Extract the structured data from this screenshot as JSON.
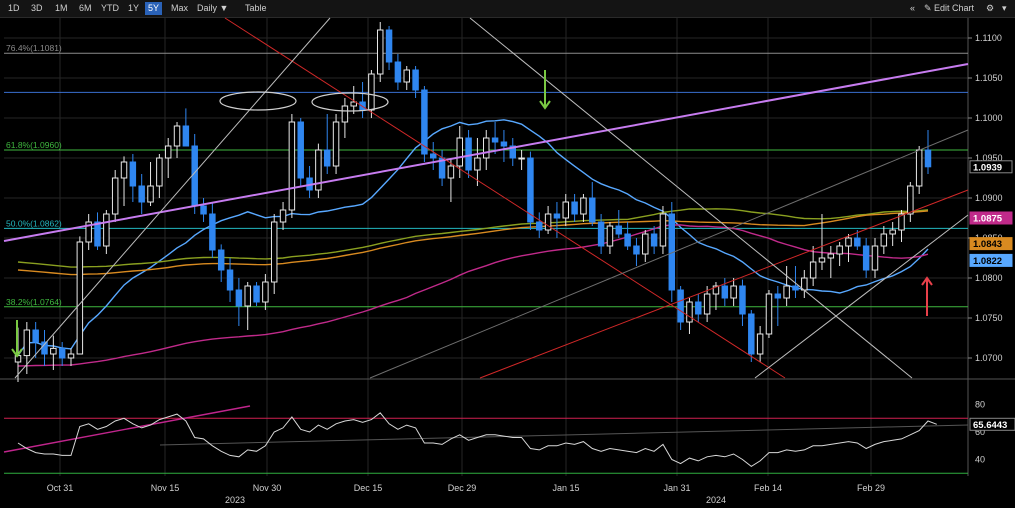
{
  "toolbar": {
    "ranges": [
      "1D",
      "3D",
      "1M",
      "6M",
      "YTD",
      "1Y",
      "5Y",
      "Max"
    ],
    "active_range": "5Y",
    "period": "Daily ▼",
    "table": "Table",
    "collapse": "«",
    "edit_chart": "✎ Edit Chart",
    "settings": "⚙",
    "minimize": "▾"
  },
  "colors": {
    "up_candle": "#e8e8e8",
    "down_candle": "#2f86f0",
    "fib": "#8c8c8c",
    "fib_618": "#3fb83f",
    "fib_382": "#3fb83f",
    "fib_500": "#23b8c0",
    "sma_blue": "#58a8ff",
    "sma_magenta": "#c02a8a",
    "sma_olive": "#8aa020",
    "sma_orange": "#d88a20",
    "trend_purple": "#c77cf0",
    "red_line": "#d02828",
    "white_line": "#bdbdbd",
    "rsi_line": "#d8d8d8"
  },
  "chart_data": {
    "type": "candlestick",
    "instrument_note": "",
    "y_axis": {
      "range": [
        1.0675,
        1.1125
      ],
      "ticks": [
        "1.1100",
        "1.1050",
        "1.1000",
        "1.0950",
        "1.0900",
        "1.0850",
        "1.0800",
        "1.0750",
        "1.0700"
      ],
      "tick_values": [
        1.11,
        1.105,
        1.1,
        1.095,
        1.09,
        1.085,
        1.08,
        1.075,
        1.07
      ]
    },
    "x_axis": {
      "ticks": [
        "Oct 31",
        "Nov 15",
        "Nov 30",
        "Dec 15",
        "Dec 29",
        "Jan 15",
        "Jan 31",
        "Feb 14",
        "Feb 29"
      ],
      "years": [
        "2023",
        "2024"
      ],
      "grid": true
    },
    "fib_levels": [
      {
        "label": "76.4%(1.1081)",
        "value": 1.1081
      },
      {
        "label": "61.8%(1.0960)",
        "value": 1.096
      },
      {
        "label": "50.0%(1.0862)",
        "value": 1.0862
      },
      {
        "label": "38.2%(1.0764)",
        "value": 1.0764
      }
    ],
    "horizontal_line": 1.1032,
    "price_tags": [
      {
        "value": 1.0939,
        "text": "1.0939",
        "bg": "#000000",
        "fg": "#ffffff"
      },
      {
        "value": 1.0875,
        "text": "1.0875",
        "bg": "#c02a8a",
        "fg": "#ffffff"
      },
      {
        "value": 1.0843,
        "text": "1.0843",
        "bg": "#d88a20",
        "fg": "#000000"
      },
      {
        "value": 1.0822,
        "text": "1.0822",
        "bg": "#58a8ff",
        "fg": "#000000"
      }
    ],
    "ohlc": [
      [
        1.0695,
        1.0738,
        1.067,
        1.0703
      ],
      [
        1.0703,
        1.0745,
        1.068,
        1.0735
      ],
      [
        1.0735,
        1.0745,
        1.07,
        1.072
      ],
      [
        1.072,
        1.0735,
        1.069,
        1.0705
      ],
      [
        1.0705,
        1.0728,
        1.0685,
        1.0712
      ],
      [
        1.0712,
        1.072,
        1.069,
        1.07
      ],
      [
        1.07,
        1.0712,
        1.069,
        1.0705
      ],
      [
        1.0705,
        1.0852,
        1.0705,
        1.0845
      ],
      [
        1.0845,
        1.088,
        1.0835,
        1.087
      ],
      [
        1.087,
        1.0882,
        1.0835,
        1.084
      ],
      [
        1.084,
        1.0885,
        1.083,
        1.088
      ],
      [
        1.088,
        1.0935,
        1.087,
        1.0925
      ],
      [
        1.0925,
        1.0952,
        1.089,
        1.0945
      ],
      [
        1.0945,
        1.0955,
        1.0895,
        1.0915
      ],
      [
        1.0915,
        1.093,
        1.088,
        1.0895
      ],
      [
        1.0895,
        1.0945,
        1.089,
        1.0915
      ],
      [
        1.0915,
        1.0955,
        1.09,
        1.095
      ],
      [
        1.095,
        1.0975,
        1.0925,
        1.0965
      ],
      [
        1.0965,
        1.0995,
        1.095,
        1.099
      ],
      [
        1.099,
        1.1012,
        1.0965,
        1.0965
      ],
      [
        1.0965,
        1.098,
        1.088,
        1.089
      ],
      [
        1.089,
        1.09,
        1.087,
        1.088
      ],
      [
        1.088,
        1.0895,
        1.0825,
        1.0835
      ],
      [
        1.0835,
        1.0842,
        1.0795,
        1.081
      ],
      [
        1.081,
        1.0825,
        1.077,
        1.0785
      ],
      [
        1.0785,
        1.08,
        1.074,
        1.0765
      ],
      [
        1.0765,
        1.0795,
        1.0735,
        1.079
      ],
      [
        1.079,
        1.0795,
        1.0765,
        1.077
      ],
      [
        1.077,
        1.0805,
        1.076,
        1.0795
      ],
      [
        1.0795,
        1.088,
        1.078,
        1.087
      ],
      [
        1.087,
        1.0895,
        1.086,
        1.0885
      ],
      [
        1.0885,
        1.1005,
        1.0875,
        1.0995
      ],
      [
        1.0995,
        1.1,
        1.0915,
        1.0925
      ],
      [
        1.0925,
        1.094,
        1.09,
        1.091
      ],
      [
        1.091,
        1.0968,
        1.09,
        1.096
      ],
      [
        1.096,
        1.1005,
        1.093,
        1.094
      ],
      [
        1.094,
        1.1005,
        1.093,
        1.0995
      ],
      [
        1.0995,
        1.1025,
        1.0975,
        1.1015
      ],
      [
        1.1015,
        1.104,
        1.1005,
        1.102
      ],
      [
        1.102,
        1.1045,
        1.1,
        1.101
      ],
      [
        1.101,
        1.106,
        1.1,
        1.1055
      ],
      [
        1.1055,
        1.112,
        1.1045,
        1.111
      ],
      [
        1.111,
        1.1115,
        1.106,
        1.107
      ],
      [
        1.107,
        1.108,
        1.1035,
        1.1045
      ],
      [
        1.1045,
        1.1065,
        1.1035,
        1.106
      ],
      [
        1.106,
        1.1065,
        1.1025,
        1.1035
      ],
      [
        1.1035,
        1.104,
        1.0945,
        1.0955
      ],
      [
        1.0955,
        1.097,
        1.0935,
        1.095
      ],
      [
        1.095,
        1.096,
        1.0915,
        1.0925
      ],
      [
        1.0925,
        1.095,
        1.0895,
        1.094
      ],
      [
        1.094,
        1.099,
        1.0925,
        1.0975
      ],
      [
        1.0975,
        1.0985,
        1.0925,
        1.0935
      ],
      [
        1.0935,
        1.0975,
        1.0915,
        1.095
      ],
      [
        1.095,
        1.0985,
        1.0935,
        1.0975
      ],
      [
        1.0975,
        1.0995,
        1.0955,
        1.097
      ],
      [
        1.097,
        1.0985,
        1.0945,
        1.0965
      ],
      [
        1.0965,
        1.0975,
        1.094,
        1.095
      ],
      [
        1.095,
        1.096,
        1.0935,
        1.095
      ],
      [
        1.095,
        1.0958,
        1.086,
        1.087
      ],
      [
        1.087,
        1.0882,
        1.085,
        1.086
      ],
      [
        1.086,
        1.089,
        1.0855,
        1.088
      ],
      [
        1.088,
        1.0895,
        1.085,
        1.0875
      ],
      [
        1.0875,
        1.0905,
        1.0865,
        1.0895
      ],
      [
        1.0895,
        1.0905,
        1.087,
        1.088
      ],
      [
        1.088,
        1.0905,
        1.087,
        1.09
      ],
      [
        1.09,
        1.092,
        1.0865,
        1.087
      ],
      [
        1.087,
        1.088,
        1.083,
        1.084
      ],
      [
        1.084,
        1.087,
        1.083,
        1.0865
      ],
      [
        1.0865,
        1.0885,
        1.085,
        1.0855
      ],
      [
        1.0855,
        1.087,
        1.0835,
        1.084
      ],
      [
        1.084,
        1.085,
        1.0815,
        1.083
      ],
      [
        1.083,
        1.086,
        1.082,
        1.0855
      ],
      [
        1.0855,
        1.0865,
        1.083,
        1.084
      ],
      [
        1.084,
        1.089,
        1.083,
        1.088
      ],
      [
        1.088,
        1.0895,
        1.077,
        1.0785
      ],
      [
        1.0785,
        1.079,
        1.0735,
        1.0745
      ],
      [
        1.0745,
        1.0775,
        1.073,
        1.077
      ],
      [
        1.077,
        1.078,
        1.0745,
        1.0755
      ],
      [
        1.0755,
        1.079,
        1.0745,
        1.078
      ],
      [
        1.078,
        1.0795,
        1.076,
        1.079
      ],
      [
        1.079,
        1.08,
        1.0765,
        1.0775
      ],
      [
        1.0775,
        1.08,
        1.0765,
        1.079
      ],
      [
        1.079,
        1.0798,
        1.074,
        1.0755
      ],
      [
        1.0755,
        1.076,
        1.0695,
        1.0705
      ],
      [
        1.0705,
        1.074,
        1.0695,
        1.073
      ],
      [
        1.073,
        1.0785,
        1.0725,
        1.078
      ],
      [
        1.078,
        1.079,
        1.074,
        1.0775
      ],
      [
        1.0775,
        1.0815,
        1.0765,
        1.079
      ],
      [
        1.079,
        1.0815,
        1.0775,
        1.0785
      ],
      [
        1.0785,
        1.081,
        1.0775,
        1.08
      ],
      [
        1.08,
        1.084,
        1.079,
        1.082
      ],
      [
        1.082,
        1.088,
        1.081,
        1.0825
      ],
      [
        1.0825,
        1.084,
        1.08,
        1.083
      ],
      [
        1.083,
        1.0845,
        1.0815,
        1.084
      ],
      [
        1.084,
        1.0855,
        1.082,
        1.085
      ],
      [
        1.085,
        1.086,
        1.0835,
        1.084
      ],
      [
        1.084,
        1.085,
        1.08,
        1.081
      ],
      [
        1.081,
        1.085,
        1.08,
        1.084
      ],
      [
        1.084,
        1.0865,
        1.083,
        1.0855
      ],
      [
        1.0855,
        1.087,
        1.084,
        1.086
      ],
      [
        1.086,
        1.0885,
        1.0845,
        1.088
      ],
      [
        1.088,
        1.092,
        1.087,
        1.0915
      ],
      [
        1.0915,
        1.0965,
        1.0905,
        1.096
      ],
      [
        1.096,
        1.0985,
        1.093,
        1.0939
      ]
    ],
    "indicator": {
      "type": "line",
      "y_axis": {
        "range": [
          28,
          92
        ],
        "ticks": [
          "80",
          "60",
          "40"
        ],
        "tick_values": [
          80,
          60,
          40
        ]
      },
      "upper_band": 70,
      "lower_band": 30,
      "last_value_text": "65.6443",
      "values": [
        52,
        48,
        45,
        44,
        44,
        43,
        43,
        64,
        66,
        62,
        64,
        68,
        70,
        66,
        63,
        65,
        69,
        71,
        73,
        68,
        56,
        55,
        50,
        46,
        43,
        42,
        47,
        46,
        50,
        60,
        63,
        71,
        62,
        60,
        65,
        62,
        66,
        68,
        69,
        67,
        69,
        74,
        66,
        62,
        65,
        63,
        52,
        52,
        51,
        55,
        58,
        54,
        56,
        58,
        58,
        57,
        56,
        56,
        48,
        47,
        50,
        50,
        52,
        51,
        53,
        48,
        46,
        48,
        47,
        46,
        45,
        48,
        46,
        51,
        40,
        37,
        41,
        39,
        42,
        43,
        42,
        44,
        40,
        35,
        39,
        45,
        45,
        47,
        46,
        47,
        50,
        50,
        51,
        52,
        53,
        52,
        48,
        51,
        53,
        54,
        55,
        58,
        61,
        68,
        65.6
      ]
    }
  }
}
